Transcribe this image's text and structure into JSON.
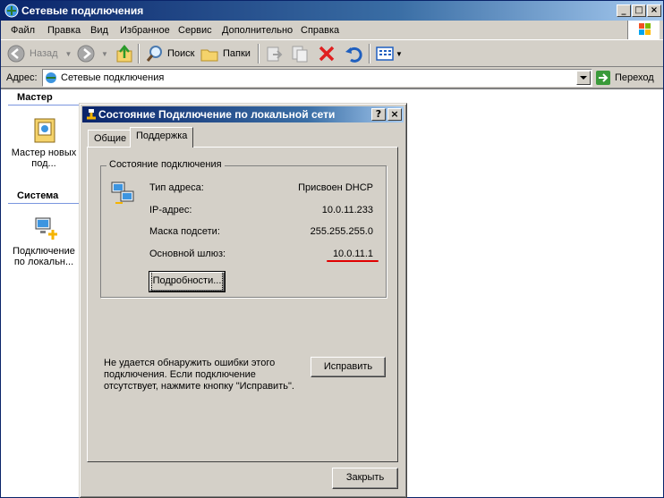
{
  "window": {
    "title": "Сетевые подключения"
  },
  "menu": [
    "Файл",
    "Правка",
    "Вид",
    "Избранное",
    "Сервис",
    "Дополнительно",
    "Справка"
  ],
  "toolbar": {
    "back": "Назад",
    "search": "Поиск",
    "folders": "Папки"
  },
  "address": {
    "label": "Адрес:",
    "value": "Сетевые подключения",
    "go": "Переход"
  },
  "left_pane": {
    "sections": [
      {
        "title": "Мастер",
        "item": "Мастер новых под..."
      },
      {
        "title": "Система",
        "item": "Подключение по локальн..."
      }
    ]
  },
  "dialog": {
    "title": "Состояние Подключение по локальной сети",
    "tabs": [
      "Общие",
      "Поддержка"
    ],
    "active_tab": "Поддержка",
    "group_title": "Состояние подключения",
    "rows": [
      {
        "label": "Тип адреса:",
        "value": "Присвоен DHCP"
      },
      {
        "label": "IP-адрес:",
        "value": "10.0.11.233"
      },
      {
        "label": "Маска подсети:",
        "value": "255.255.255.0"
      },
      {
        "label": "Основной шлюз:",
        "value": "10.0.11.1"
      }
    ],
    "details_button": "Подробности...",
    "note": "Не удается обнаружить ошибки этого подключения. Если подключение отсутствует, нажмите кнопку \"Исправить\".",
    "repair_button": "Исправить",
    "close_button": "Закрыть"
  },
  "colors": {
    "title_bar": "#0a246a",
    "dialog_face": "#d4d0c8",
    "highlight_line": "#e00000"
  }
}
